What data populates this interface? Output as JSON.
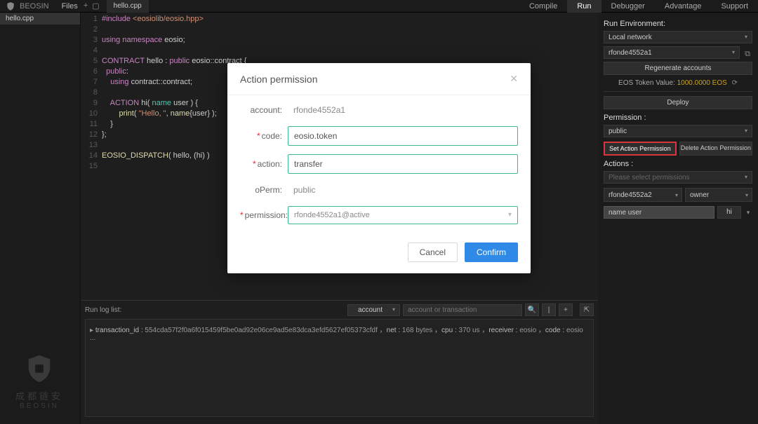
{
  "brand": {
    "name": "成都链安",
    "sub": "BEOSIN"
  },
  "topbar": {
    "files": "Files",
    "tab": "hello.cpp",
    "items": [
      "Compile",
      "Run",
      "Debugger",
      "Advantage",
      "Support"
    ],
    "active_index": 1
  },
  "sidebar": {
    "file": "hello.cpp"
  },
  "editor": {
    "lines": [
      {
        "n": 1,
        "html": "<span class='kw'>#include</span> <span class='str'>&lt;eosiolib/eosio.hpp&gt;</span>"
      },
      {
        "n": 2,
        "html": ""
      },
      {
        "n": 3,
        "html": "<span class='kw'>using</span> <span class='kw'>namespace</span> eosio;"
      },
      {
        "n": 4,
        "html": ""
      },
      {
        "n": 5,
        "html": "<span class='kw'>CONTRACT</span> hello : <span class='kw'>public</span> eosio::contract {"
      },
      {
        "n": 6,
        "html": "  <span class='kw'>public</span>:"
      },
      {
        "n": 7,
        "html": "    <span class='kw'>using</span> contract::contract;"
      },
      {
        "n": 8,
        "html": ""
      },
      {
        "n": 9,
        "html": "    <span class='kw'>ACTION</span> hi( <span class='ty'>name</span> user ) {"
      },
      {
        "n": 10,
        "html": "        <span class='fn'>print</span>( <span class='str'>\"Hello, \"</span>, <span class='fn'>name</span>{user} );"
      },
      {
        "n": 11,
        "html": "    }"
      },
      {
        "n": 12,
        "html": "};"
      },
      {
        "n": 13,
        "html": ""
      },
      {
        "n": 14,
        "html": "<span class='fn'>EOSIO_DISPATCH</span>( hello, (hi) )"
      },
      {
        "n": 15,
        "html": ""
      }
    ]
  },
  "log": {
    "title": "Run log list:",
    "account_label": "account",
    "search_placeholder": "account or transaction",
    "entry": {
      "tx_label": "transaction_id :",
      "tx": "554cda57f2f0a6f015459f5be0ad92e06ce9ad5e83dca3efd5627ef05373cfdf",
      "net_label": "net :",
      "net": "168 bytes",
      "cpu_label": "cpu :",
      "cpu": "370 us",
      "rcv_label": "receiver :",
      "rcv": "eosio",
      "code_label": "code :",
      "code": "eosio ..."
    }
  },
  "right": {
    "env_title": "Run Environment:",
    "network": "Local network",
    "account": "rfonde4552a1",
    "regen": "Regenerate accounts",
    "token_label": "EOS Token Value:",
    "token_value": "1000.0000 EOS",
    "deploy": "Deploy",
    "perm_title": "Permission :",
    "perm_value": "public",
    "set_action": "Set Action Permission",
    "del_action": "Delete Action Permission",
    "actions_title": "Actions :",
    "actions_placeholder": "Please select permissions",
    "acc2": "rfonde4552a2",
    "owner": "owner",
    "name_user": "name user",
    "hi": "hi"
  },
  "modal": {
    "title": "Action permission",
    "account_label": "account:",
    "account_value": "rfonde4552a1",
    "code_label": "code:",
    "code_value": "eosio.token",
    "action_label": "action:",
    "action_value": "transfer",
    "operm_label": "oPerm:",
    "operm_value": "public",
    "perm_label": "permission:",
    "perm_value": "rfonde4552a1@active",
    "cancel": "Cancel",
    "confirm": "Confirm"
  },
  "watermark": {
    "cn": "成都链安",
    "en": "BEOSIN"
  }
}
